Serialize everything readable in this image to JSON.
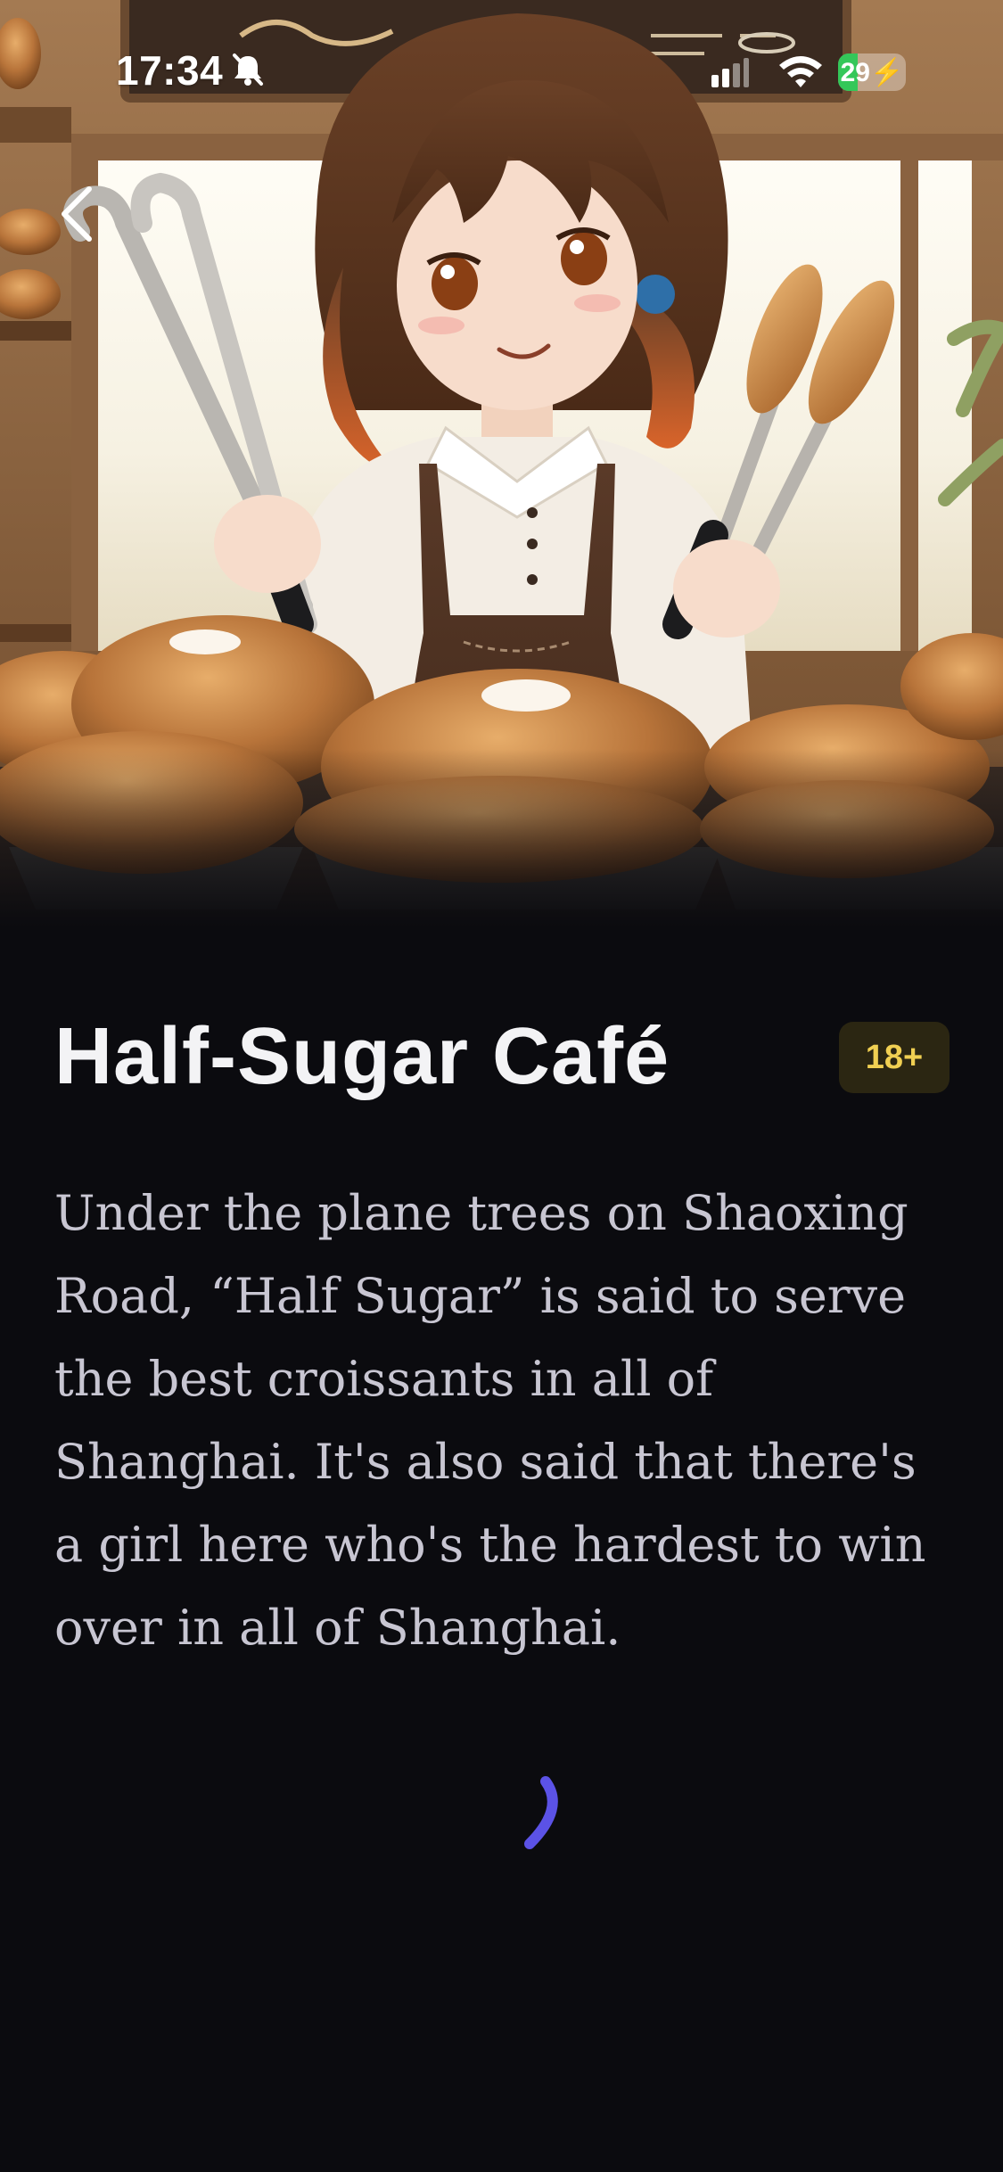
{
  "status_bar": {
    "time": "17:34",
    "battery_percent": 29,
    "battery_label": "29",
    "icons": [
      "bell-off-icon",
      "signal-icon",
      "wifi-icon",
      "battery-charging-icon"
    ]
  },
  "nav": {
    "back_icon": "chevron-left-icon"
  },
  "hero": {
    "image_subject": "anime girl holding tongs and breadsticks in a bakery café with croissants on display"
  },
  "story": {
    "title": "Half-Sugar Café",
    "age_rating": "18+",
    "description": "Under the plane trees on Shaoxing Road, “Half Sugar” is said to serve the best croissants in all of Shanghai. It's also said that there's a girl here who's the hardest to win over in all of Shanghai."
  },
  "loading": {
    "icon": "loading-spinner-icon",
    "color": "#5b52e6"
  },
  "colors": {
    "background": "#0b0b0f",
    "badge_bg": "#2b2612",
    "badge_text": "#f0cf52",
    "accent": "#5b52e6"
  }
}
